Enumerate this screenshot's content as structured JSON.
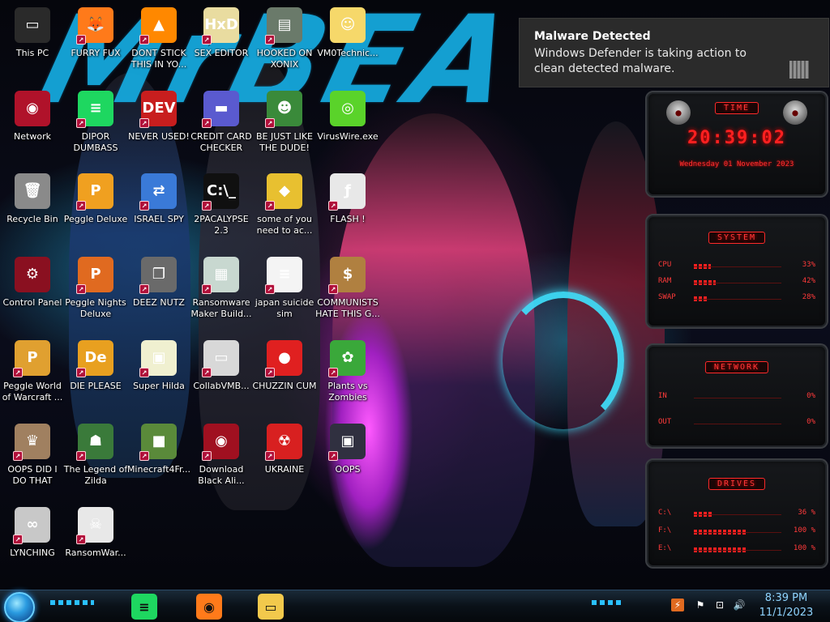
{
  "wallpaper": {
    "text_left": "MrBEA",
    "text_right": ""
  },
  "desktop_icons": [
    {
      "label": "This PC",
      "icon": "computer-icon",
      "color": "#2a2a2a",
      "glyph": "▭",
      "shortcut": false
    },
    {
      "label": "FURRY FUX",
      "icon": "firefox-icon",
      "color": "#ff7a1a",
      "glyph": "🦊",
      "shortcut": true
    },
    {
      "label": "DONT STICK THIS IN YO...",
      "icon": "vlc-cone-icon",
      "color": "#ff8800",
      "glyph": "▲",
      "shortcut": true
    },
    {
      "label": "SEX EDITOR",
      "icon": "hxd-icon",
      "color": "#e9dca0",
      "glyph": "HxD",
      "shortcut": true
    },
    {
      "label": "HOOKED ON XONIX",
      "icon": "xonix-icon",
      "color": "#6a7a6a",
      "glyph": "▤",
      "shortcut": true
    },
    {
      "label": "VM0Technic...",
      "icon": "cartoon-face-icon",
      "color": "#f6d86a",
      "glyph": "☺",
      "shortcut": false
    },
    {
      "label": "Network",
      "icon": "alienware-network-icon",
      "color": "#b0122a",
      "glyph": "◉",
      "shortcut": false
    },
    {
      "label": "DIPOR DUMBASS",
      "icon": "spotify-icon",
      "color": "#1ed760",
      "glyph": "≡",
      "shortcut": true
    },
    {
      "label": "NEVER USED!",
      "icon": "dev-cpp-icon",
      "color": "#c81e1e",
      "glyph": "DEV",
      "shortcut": true
    },
    {
      "label": "CREDIT CARD CHECKER",
      "icon": "credit-card-icon",
      "color": "#5a5acf",
      "glyph": "▬",
      "shortcut": true
    },
    {
      "label": "BE JUST LIKE THE DUDE!",
      "icon": "dude-icon",
      "color": "#3a8a3a",
      "glyph": "☻",
      "shortcut": true
    },
    {
      "label": "VirusWire.exe",
      "icon": "limewire-icon",
      "color": "#5ad32a",
      "glyph": "◎",
      "shortcut": false
    },
    {
      "label": "Recycle Bin",
      "icon": "recycle-bin-icon",
      "color": "#8a8a8a",
      "glyph": "🗑",
      "shortcut": false
    },
    {
      "label": "Peggle Deluxe",
      "icon": "peggle-icon",
      "color": "#f0a020",
      "glyph": "P",
      "shortcut": true
    },
    {
      "label": "ISRAEL SPY",
      "icon": "screen-share-icon",
      "color": "#3a7ad8",
      "glyph": "⇄",
      "shortcut": true
    },
    {
      "label": "2PACALYPSE 2.3",
      "icon": "terminal-icon",
      "color": "#101010",
      "glyph": "C:\\_",
      "shortcut": true
    },
    {
      "label": "some of you need to ac...",
      "icon": "beaver-icon",
      "color": "#e8c030",
      "glyph": "◆",
      "shortcut": true
    },
    {
      "label": "FLASH !",
      "icon": "flash-document-icon",
      "color": "#e8e8e8",
      "glyph": "ƒ",
      "shortcut": true
    },
    {
      "label": "Control Panel",
      "icon": "control-panel-icon",
      "color": "#8a1020",
      "glyph": "⚙",
      "shortcut": false
    },
    {
      "label": "Peggle Nights Deluxe",
      "icon": "peggle-nights-icon",
      "color": "#e06a20",
      "glyph": "P",
      "shortcut": true
    },
    {
      "label": "DEEZ NUTZ",
      "icon": "stacked-windows-icon",
      "color": "#6a6a6a",
      "glyph": "❐",
      "shortcut": true
    },
    {
      "label": "Ransomware Maker Build...",
      "icon": "app-window-icon",
      "color": "#c8d8d0",
      "glyph": "▦",
      "shortcut": true
    },
    {
      "label": "japan suicide sim",
      "icon": "document-icon",
      "color": "#f4f4f4",
      "glyph": "≡",
      "shortcut": true
    },
    {
      "label": "COMMUNISTS HATE THIS G...",
      "icon": "money-bag-icon",
      "color": "#b08040",
      "glyph": "$",
      "shortcut": true
    },
    {
      "label": "Peggle World of Warcraft ...",
      "icon": "peggle-wow-icon",
      "color": "#e0a030",
      "glyph": "P",
      "shortcut": true
    },
    {
      "label": "DIE PLEASE",
      "icon": "adobe-director-icon",
      "color": "#e8a020",
      "glyph": "De",
      "shortcut": true
    },
    {
      "label": "Super Hilda",
      "icon": "pixel-game-icon",
      "color": "#f0f0d0",
      "glyph": "▣",
      "shortcut": true
    },
    {
      "label": "CollabVMB...",
      "icon": "collabvm-icon",
      "color": "#d8d8d8",
      "glyph": "▭",
      "shortcut": true
    },
    {
      "label": "CHUZZIN CUM",
      "icon": "chuzzle-icon",
      "color": "#e02020",
      "glyph": "●",
      "shortcut": true
    },
    {
      "label": "Plants vs Zombies",
      "icon": "flower-icon",
      "color": "#3aa83a",
      "glyph": "✿",
      "shortcut": true
    },
    {
      "label": "OOPS DID I DO THAT",
      "icon": "portrait-icon",
      "color": "#a08060",
      "glyph": "♛",
      "shortcut": true
    },
    {
      "label": "The Legend of Zilda",
      "icon": "zelda-sprite-icon",
      "color": "#3a7a3a",
      "glyph": "☗",
      "shortcut": true
    },
    {
      "label": "Minecraft4Fr...",
      "icon": "minecraft-block-icon",
      "color": "#5a8a3a",
      "glyph": "■",
      "shortcut": true
    },
    {
      "label": "Download Black Ali...",
      "icon": "alienware-download-icon",
      "color": "#a01020",
      "glyph": "◉",
      "shortcut": true
    },
    {
      "label": "UKRAINE",
      "icon": "radiation-icon",
      "color": "#d82020",
      "glyph": "☢",
      "shortcut": true
    },
    {
      "label": "OOPS",
      "icon": "app-dark-icon",
      "color": "#303040",
      "glyph": "▣",
      "shortcut": true
    },
    {
      "label": "LYNCHING",
      "icon": "knot-flag-icon",
      "color": "#c8c8c8",
      "glyph": "∞",
      "shortcut": true
    },
    {
      "label": "RansomWar...",
      "icon": "skull-icon",
      "color": "#e8e8e8",
      "glyph": "☠",
      "shortcut": true
    }
  ],
  "notification": {
    "title": "Malware Detected",
    "body": "Windows Defender is taking action to clean detected malware."
  },
  "widgets": {
    "time": {
      "title": "TIME",
      "clock": "20:39:02",
      "date": "Wednesday 01 November 2023"
    },
    "system": {
      "title": "SYSTEM",
      "rows": [
        {
          "label": "CPU",
          "value": "33%",
          "fraction": 0.33
        },
        {
          "label": "RAM",
          "value": "42%",
          "fraction": 0.42
        },
        {
          "label": "SWAP",
          "value": "28%",
          "fraction": 0.28
        }
      ]
    },
    "network": {
      "title": "NETWORK",
      "rows": [
        {
          "label": "IN",
          "value": "0%",
          "fraction": 0
        },
        {
          "label": "OUT",
          "value": "0%",
          "fraction": 0
        }
      ]
    },
    "drives": {
      "title": "DRIVES",
      "rows": [
        {
          "label": "C:\\",
          "value": "36 %",
          "fraction": 0.36
        },
        {
          "label": "F:\\",
          "value": "100 %",
          "fraction": 1.0
        },
        {
          "label": "E:\\",
          "value": "100 %",
          "fraction": 1.0
        }
      ]
    }
  },
  "taskbar": {
    "pinned": [
      {
        "name": "spotify",
        "icon": "spotify-icon",
        "color": "#1ed760"
      },
      {
        "name": "firefox",
        "icon": "firefox-icon",
        "color": "#ff7a1a"
      },
      {
        "name": "file-explorer",
        "icon": "folder-icon",
        "color": "#f2c94c"
      }
    ],
    "time": "8:39 PM",
    "date": "11/1/2023"
  },
  "colors": {
    "accent_red": "#ff2a2a",
    "taskbar_accent": "#2ac0ff"
  }
}
